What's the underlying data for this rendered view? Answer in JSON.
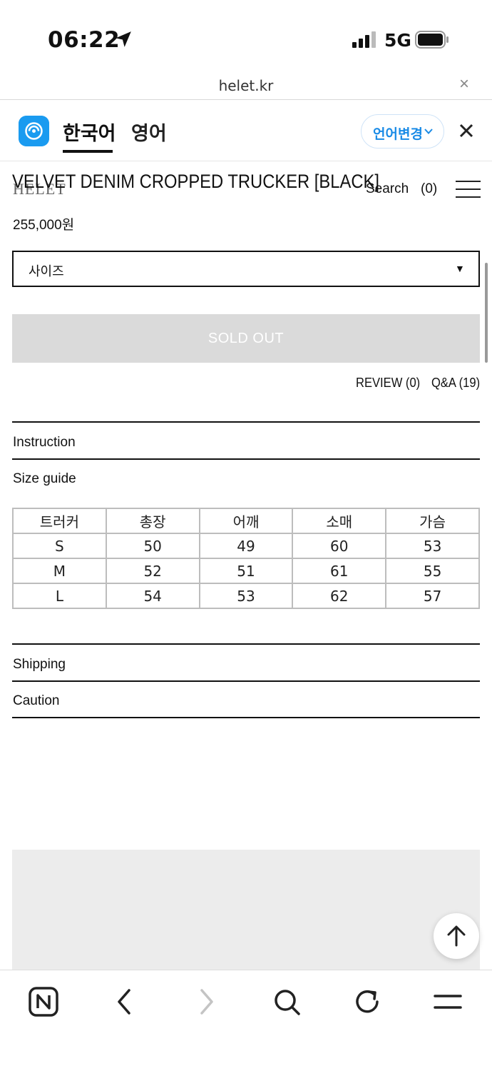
{
  "status_bar": {
    "time": "06:22",
    "network": "5G"
  },
  "browser": {
    "url": "helet.kr",
    "close_label": "×"
  },
  "translate_bar": {
    "current_lang": "한국어",
    "target_lang": "영어",
    "change_button": "언어변경"
  },
  "header": {
    "logo": "HELET",
    "search": "Search",
    "cart_count": "(0)"
  },
  "product": {
    "title": "VELVET DENIM CROPPED TRUCKER [BLACK]",
    "price": "255,000원",
    "size_select": "사이즈",
    "sold_out": "SOLD OUT",
    "review": "REVIEW (0)",
    "qna": "Q&A (19)"
  },
  "sections": {
    "instruction": "Instruction",
    "size_guide": "Size guide",
    "shipping": "Shipping",
    "caution": "Caution"
  },
  "size_table": {
    "headers": [
      "트러커",
      "총장",
      "어깨",
      "소매",
      "가슴"
    ],
    "rows": [
      [
        "S",
        "50",
        "49",
        "60",
        "53"
      ],
      [
        "M",
        "52",
        "51",
        "61",
        "55"
      ],
      [
        "L",
        "54",
        "53",
        "62",
        "57"
      ]
    ]
  },
  "icons": {
    "location": "location-arrow-icon",
    "signal": "cellular-signal-icon",
    "battery": "battery-icon",
    "papago": "papago-icon",
    "menu": "hamburger-menu-icon",
    "top": "arrow-up-icon",
    "bottom": [
      "naver-home-icon",
      "back-icon",
      "forward-icon",
      "search-icon",
      "refresh-icon",
      "menu-icon"
    ]
  },
  "colors": {
    "accent": "#1a9bf0",
    "sold_out_bg": "#dadada",
    "text": "#111111"
  }
}
